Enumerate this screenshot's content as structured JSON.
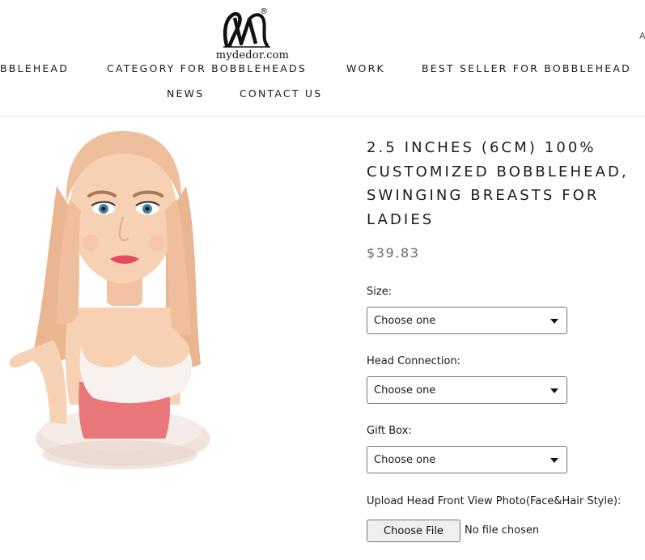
{
  "brand": {
    "name": "mydedor.com",
    "registered": "®",
    "logo_icon": "monogram-m-logo"
  },
  "nav": {
    "items": [
      "BBLEHEAD",
      "CATEGORY FOR BOBBLEHEADS",
      "WORK",
      "BEST SELLER FOR BOBBLEHEAD",
      "NEWS",
      "CONTACT US"
    ],
    "corner_glyph": "A"
  },
  "product": {
    "title": "2.5 INCHES (6CM) 100% CUSTOMIZED BOBBLEHEAD, SWINGING BREASTS FOR LADIES",
    "price": "$39.83",
    "image_icon": "bobblehead-figure-image",
    "options": [
      {
        "label": "Size:",
        "selected": "Choose one"
      },
      {
        "label": "Head Connection:",
        "selected": "Choose one"
      },
      {
        "label": "Gift Box:",
        "selected": "Choose one"
      }
    ],
    "upload": {
      "label": "Upload Head Front View Photo(Face&Hair Style):",
      "button": "Choose File",
      "status": "No file chosen"
    }
  },
  "colors": {
    "text": "#1c1b1b",
    "price": "#6a6a6a",
    "border": "#767676"
  }
}
